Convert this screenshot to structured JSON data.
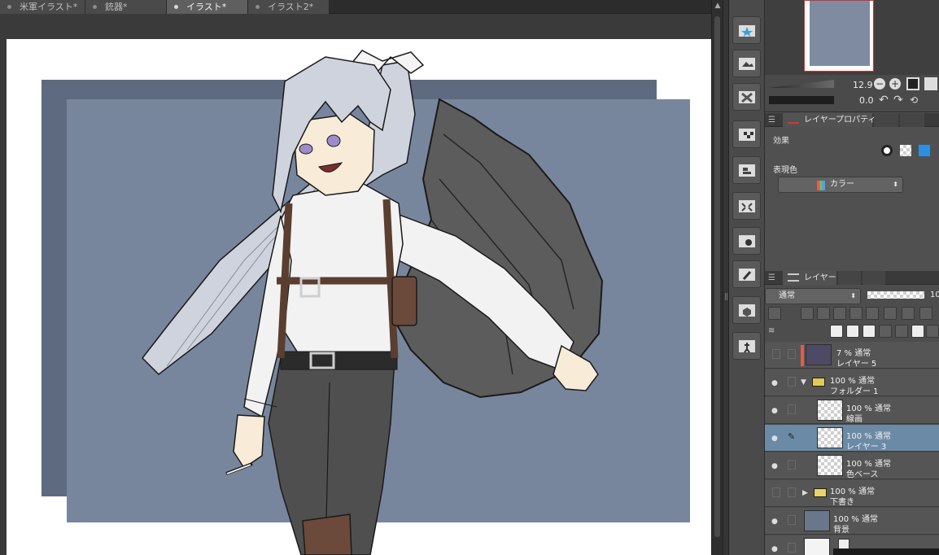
{
  "tabs": [
    {
      "label": "米軍イラスト*",
      "active": false
    },
    {
      "label": "銃器*",
      "active": false
    },
    {
      "label": "イラスト*",
      "active": true
    },
    {
      "label": "イラスト2*",
      "active": false
    }
  ],
  "navigator": {
    "zoom": "12.9",
    "rotation": "0.0"
  },
  "layer_property_panel": {
    "tab_label": "レイヤープロパティ",
    "effect_label": "効果",
    "expression_color_label": "表現色",
    "expression_color_value": "カラー"
  },
  "layer_panel": {
    "tab_label": "レイヤー",
    "blend_mode": "通常",
    "opacity_partial": "10",
    "layers": [
      {
        "opacity_mode": "7 % 通常",
        "name": "レイヤー 5",
        "thumb": "#4d4a63",
        "color_tag": "#d5634f",
        "indent": 0,
        "selected": false,
        "folder": false
      },
      {
        "opacity_mode": "100 % 通常",
        "name": "フォルダー 1",
        "thumb": "folder",
        "indent": 0,
        "selected": false,
        "folder": true,
        "expanded": true
      },
      {
        "opacity_mode": "100 % 通常",
        "name": "線画",
        "thumb": "checker",
        "indent": 1,
        "selected": false,
        "folder": false
      },
      {
        "opacity_mode": "100 % 通常",
        "name": "レイヤー 3",
        "thumb": "checker",
        "indent": 1,
        "selected": true,
        "folder": false
      },
      {
        "opacity_mode": "100 % 通常",
        "name": "色ベース",
        "thumb": "checker",
        "indent": 1,
        "selected": false,
        "folder": false
      },
      {
        "opacity_mode": "100 % 通常",
        "name": "下書き",
        "thumb": "folder",
        "indent": 0,
        "selected": false,
        "folder": true,
        "expanded": false
      },
      {
        "opacity_mode": "100 % 通常",
        "name": "背景",
        "thumb": "#6a768a",
        "indent": 0,
        "selected": false,
        "folder": false
      }
    ]
  },
  "colors": {
    "canvas_bg_dark": "#5d6a7f",
    "canvas_bg_main": "#78869d",
    "selected_layer": "#6b8aa6",
    "panel": "#505050"
  }
}
